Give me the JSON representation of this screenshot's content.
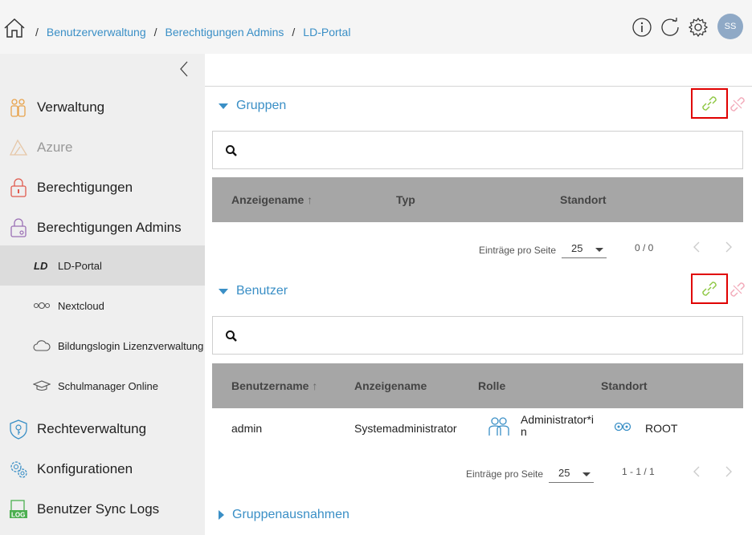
{
  "breadcrumb": {
    "items": [
      "Benutzerverwaltung",
      "Berechtigungen Admins",
      "LD-Portal"
    ],
    "separator": "/"
  },
  "header": {
    "avatar_initials": "SS"
  },
  "sidebar": {
    "items": [
      {
        "label": "Verwaltung",
        "icon": "admin-icon",
        "disabled": false
      },
      {
        "label": "Azure",
        "icon": "azure-icon",
        "disabled": true
      },
      {
        "label": "Berechtigungen",
        "icon": "lock-icon",
        "disabled": false
      },
      {
        "label": "Berechtigungen Admins",
        "icon": "admin-lock-icon",
        "disabled": false
      }
    ],
    "subitems": [
      {
        "label": "LD-Portal",
        "icon": "ld-logo-icon",
        "active": true
      },
      {
        "label": "Nextcloud",
        "icon": "nextcloud-icon",
        "active": false
      },
      {
        "label": "Bildungslogin Lizenzverwaltung",
        "icon": "cloud-icon",
        "active": false
      },
      {
        "label": "Schulmanager Online",
        "icon": "graduation-cap-icon",
        "active": false
      }
    ],
    "items_bottom": [
      {
        "label": "Rechteverwaltung",
        "icon": "key-shield-icon"
      },
      {
        "label": "Konfigurationen",
        "icon": "gears-icon"
      },
      {
        "label": "Benutzer Sync Logs",
        "icon": "log-icon"
      }
    ]
  },
  "gruppen": {
    "title": "Gruppen",
    "columns": [
      "Anzeigename",
      "Typ",
      "Standort"
    ],
    "sort_arrow": "↑",
    "pagination": {
      "per_page_label": "Einträge pro Seite",
      "per_page": "25",
      "range": "0 / 0"
    }
  },
  "benutzer": {
    "title": "Benutzer",
    "columns": [
      "Benutzername",
      "Anzeigename",
      "Rolle",
      "Standort"
    ],
    "sort_arrow": "↑",
    "rows": [
      {
        "username": "admin",
        "display_name": "Systemadministrator",
        "role_line1": "Administrator*i",
        "role_line2": "n",
        "location": "ROOT"
      }
    ],
    "pagination": {
      "per_page_label": "Einträge pro Seite",
      "per_page": "25",
      "range": "1 - 1 / 1"
    }
  },
  "gruppenausnahmen": {
    "title": "Gruppenausnahmen"
  },
  "colors": {
    "accent": "#3a8fc6",
    "link_green": "#8cc63f",
    "unlink_pink": "#f2a8b8",
    "highlight_red": "#e00000",
    "table_header": "#a6a6a6",
    "sidebar_bg": "#efefef"
  }
}
